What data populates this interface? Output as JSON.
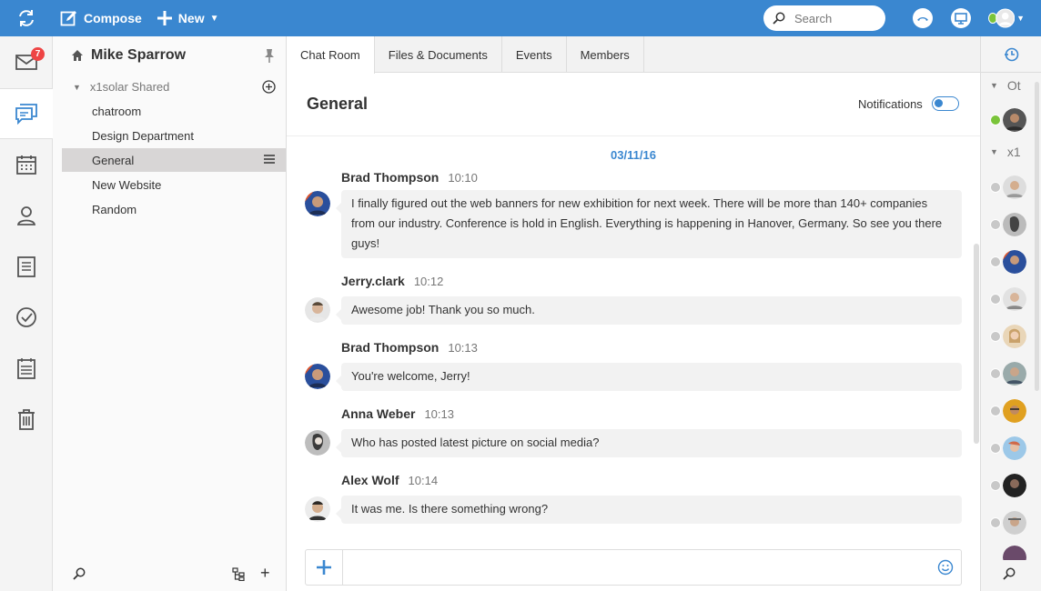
{
  "topbar": {
    "compose_label": "Compose",
    "new_label": "New",
    "search_placeholder": "Search",
    "brand_color": "#3a87d0"
  },
  "rail": {
    "mail_badge": "7",
    "items": [
      "mail-icon",
      "chat-icon",
      "calendar-icon",
      "contacts-icon",
      "notes-icon",
      "tasks-icon",
      "schedule-icon",
      "trash-icon"
    ]
  },
  "folders": {
    "owner": "Mike Sparrow",
    "group": "x1solar Shared",
    "items": [
      {
        "label": "chatroom",
        "active": false
      },
      {
        "label": "Design Department",
        "active": false
      },
      {
        "label": "General",
        "active": true
      },
      {
        "label": "New Website",
        "active": false
      },
      {
        "label": "Random",
        "active": false
      }
    ]
  },
  "tabs": [
    {
      "label": "Chat Room",
      "active": true
    },
    {
      "label": "Files & Documents",
      "active": false
    },
    {
      "label": "Events",
      "active": false
    },
    {
      "label": "Members",
      "active": false
    }
  ],
  "channel": {
    "title": "General",
    "notifications_label": "Notifications",
    "notifications_on": true,
    "date": "03/11/16"
  },
  "messages": [
    {
      "author": "Brad Thompson",
      "time": "10:10",
      "text": "I finally figured out the web banners for new exhibition for next week. There will be more than 140+ companies from our industry. Conference is hold in English. Everything is happening in Hanover, Germany. So see you there guys!"
    },
    {
      "author": "Jerry.clark",
      "time": "10:12",
      "text": "Awesome job! Thank you so much."
    },
    {
      "author": "Brad Thompson",
      "time": "10:13",
      "text": "You're welcome, Jerry!"
    },
    {
      "author": "Anna Weber",
      "time": "10:13",
      "text": "Who has posted latest picture on social media?"
    },
    {
      "author": "Alex Wolf",
      "time": "10:14",
      "text": "It was me. Is there something wrong?"
    }
  ],
  "contacts": {
    "group1": "Ot",
    "group2": "x1",
    "status_colors": {
      "online": "#7ac43a",
      "offline": "#c8c8c8"
    }
  }
}
